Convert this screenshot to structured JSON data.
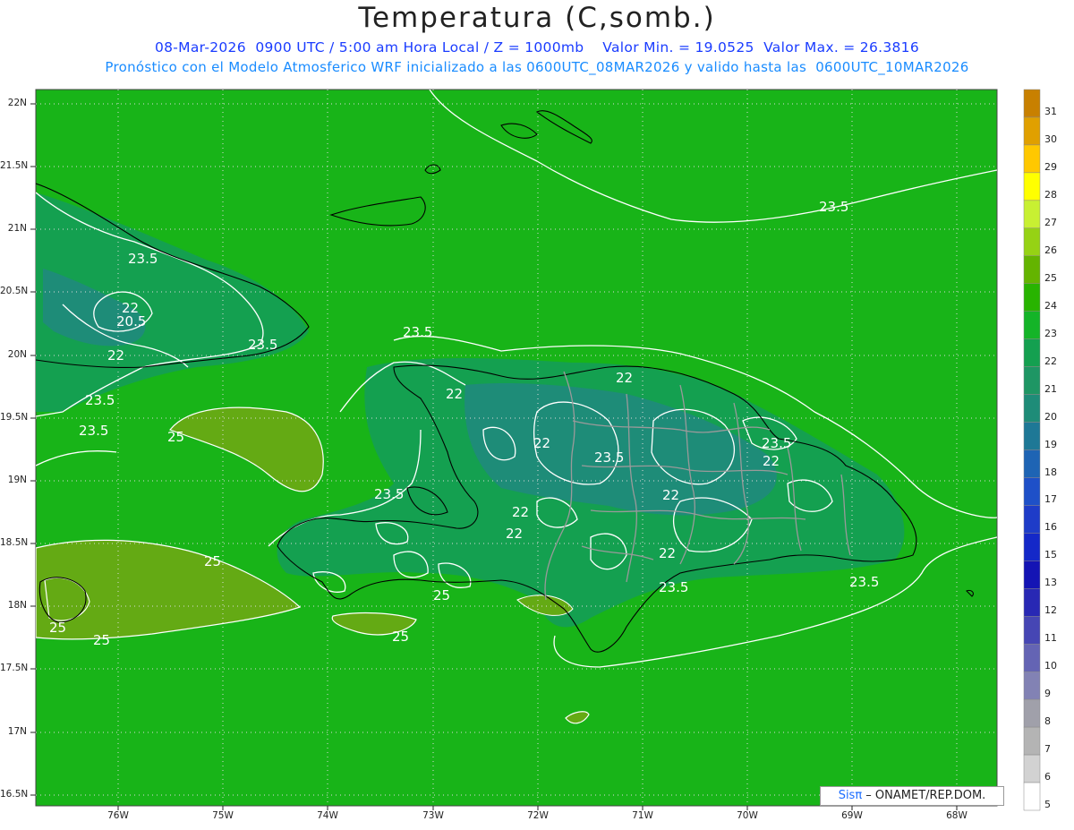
{
  "header": {
    "title": "Temperatura (C,somb.)",
    "subtitle1": "08-Mar-2026  0900 UTC / 5:00 am Hora Local / Z = 1000mb    Valor Min. = 19.0525  Valor Max. = 26.3816",
    "subtitle2": "Pronóstico con el Modelo Atmosferico WRF inicializado a las 0600UTC_08MAR2026 y valido hasta las  0600UTC_10MAR2026"
  },
  "axes": {
    "lat_labels": [
      "22N",
      "21.5N",
      "21N",
      "20.5N",
      "20N",
      "19.5N",
      "19N",
      "18.5N",
      "18N",
      "17.5N",
      "17N",
      "16.5N"
    ],
    "lon_labels": [
      "76W",
      "75W",
      "74W",
      "73W",
      "72W",
      "71W",
      "70W",
      "69W",
      "68W"
    ]
  },
  "legend": {
    "values": [
      "31",
      "30",
      "29",
      "28",
      "27",
      "26",
      "25",
      "24",
      "23",
      "22",
      "21",
      "20",
      "19",
      "18",
      "17",
      "16",
      "15",
      "13",
      "12",
      "11",
      "10",
      "9",
      "8",
      "7",
      "6",
      "5"
    ],
    "colors": [
      "#c88000",
      "#e0a000",
      "#ffc800",
      "#ffff00",
      "#c8f032",
      "#96d214",
      "#64b400",
      "#28b400",
      "#14b428",
      "#14a050",
      "#1e9664",
      "#1e8c78",
      "#1e7896",
      "#1e64b4",
      "#1e50c8",
      "#1e3cc8",
      "#1428c8",
      "#1414b4",
      "#2828b4",
      "#4646b4",
      "#6464b4",
      "#8282b4",
      "#a0a0aa",
      "#b4b4b4",
      "#d2d2d2",
      "#ffffff"
    ]
  },
  "contour_labels": [
    "23.5",
    "23.5",
    "23.5",
    "23.5",
    "23.5",
    "23.5",
    "23.5",
    "23.5",
    "23.5",
    "23.5",
    "23.5",
    "22",
    "22",
    "22",
    "22",
    "22",
    "22",
    "22",
    "22",
    "22",
    "22",
    "20.5",
    "25",
    "25",
    "25",
    "25",
    "25",
    "25"
  ],
  "credit": {
    "sis": "Sisπ",
    "rest": " – ONAMET/REP.DOM."
  },
  "colors": {
    "base_field": "#18b418",
    "cool_field": "#14a050",
    "cooler_field": "#1e8c78",
    "warm_field": "#64aa14",
    "contour": "#ffffff",
    "coast": "#000000",
    "border": "#999999"
  }
}
